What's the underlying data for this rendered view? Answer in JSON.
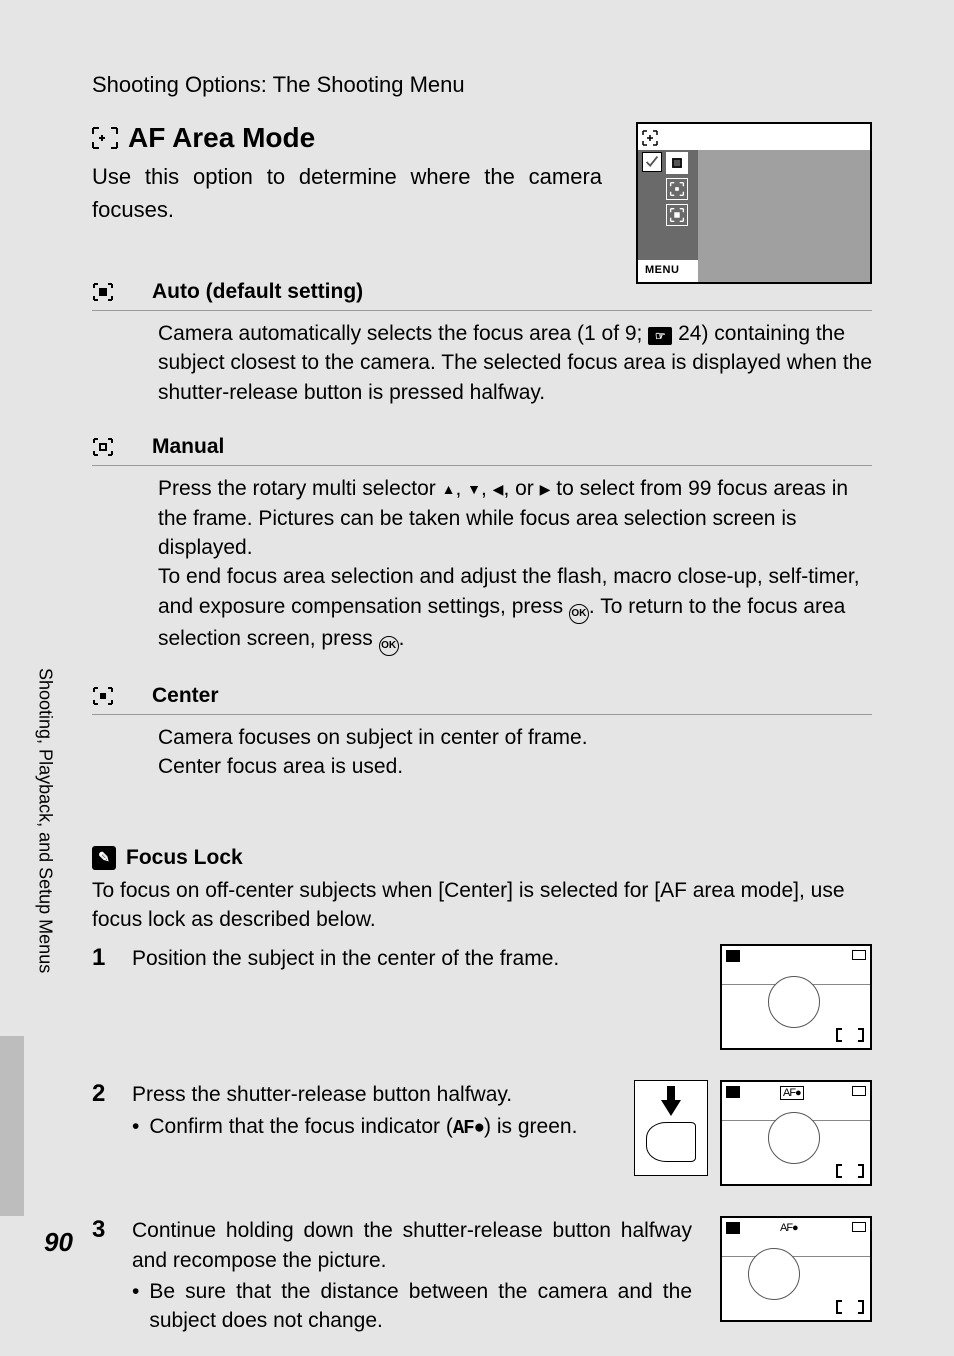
{
  "breadcrumb": "Shooting Options: The Shooting Menu",
  "sidebar_label": "Shooting, Playback, and Setup Menus",
  "page_number": "90",
  "h1": "AF Area Mode",
  "intro": "Use this option to determine where the camera focuses.",
  "menu_label": "MENU",
  "page_ref": "24",
  "defs": {
    "auto": {
      "title": "Auto (default setting)",
      "body_pre": "Camera automatically selects the focus area (1 of 9; ",
      "body_post": ") containing the subject closest to the camera. The selected focus area is displayed when the shutter-release button is pressed halfway."
    },
    "manual": {
      "title": "Manual",
      "body1_pre": "Press the rotary multi selector ",
      "body1_mid": " to select from 99 focus areas in the frame. Pictures can be taken while focus area selection screen is displayed.",
      "body2_pre": "To end focus area selection and adjust the flash, macro close-up, self-timer, and exposure compensation settings, press ",
      "body2_mid": ". To return to the focus area selection screen, press ",
      "body2_post": "."
    },
    "center": {
      "title": "Center",
      "line1": "Camera focuses on subject in center of frame.",
      "line2": "Center focus area is used."
    }
  },
  "focus_lock": {
    "title": "Focus Lock",
    "intro": "To focus on off-center subjects when [Center] is selected for [AF area mode], use focus lock as described below.",
    "steps": {
      "s1": {
        "num": "1",
        "text": "Position the subject in the center of the frame."
      },
      "s2": {
        "num": "2",
        "text": "Press the shutter-release button halfway.",
        "bullet_pre": "Confirm that the focus indicator (",
        "bullet_glyph": "AF●",
        "bullet_post": ") is green."
      },
      "s3": {
        "num": "3",
        "text": "Continue holding down the shutter-release button halfway and recompose the picture.",
        "bullet": "Be sure that the distance between the camera and the subject does not change."
      }
    }
  },
  "ok_label": "OK",
  "thumb_af": "AF●"
}
